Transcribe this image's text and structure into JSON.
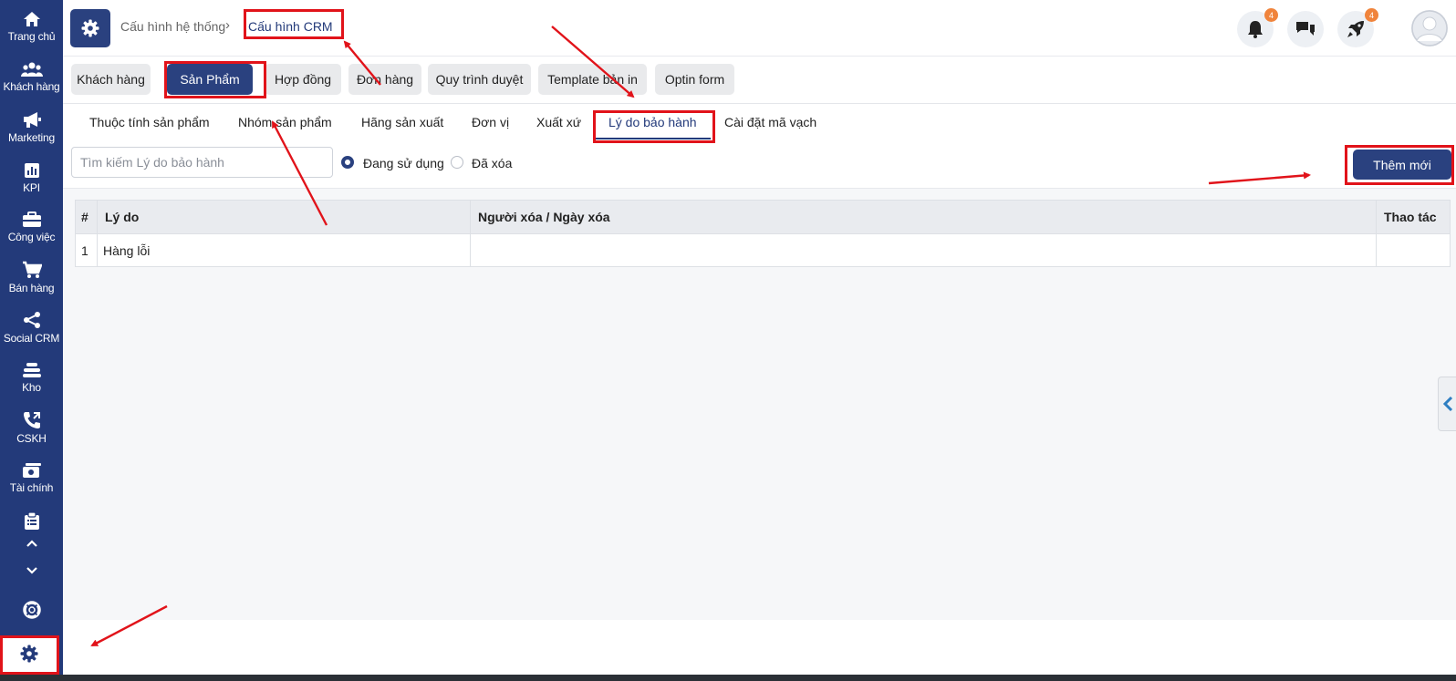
{
  "sidebar": {
    "items": [
      {
        "label": "Trang chủ",
        "icon": "home-icon"
      },
      {
        "label": "Khách hàng",
        "icon": "users-icon"
      },
      {
        "label": "Marketing",
        "icon": "megaphone-icon"
      },
      {
        "label": "KPI",
        "icon": "bar-chart-icon"
      },
      {
        "label": "Công việc",
        "icon": "briefcase-icon"
      },
      {
        "label": "Bán hàng",
        "icon": "cart-icon"
      },
      {
        "label": "Social CRM",
        "icon": "share-icon"
      },
      {
        "label": "Kho",
        "icon": "stack-icon"
      },
      {
        "label": "CSKH",
        "icon": "phone-icon"
      },
      {
        "label": "Tài chính",
        "icon": "money-icon"
      }
    ],
    "extra_icons": [
      "clipboard-icon",
      "chevron-up-icon",
      "chevron-down-icon",
      "lifebuoy-icon",
      "gear-icon"
    ]
  },
  "header": {
    "breadcrumb": {
      "parent": "Cấu hình hệ thống",
      "separator": "›",
      "current": "Cấu hình CRM"
    },
    "notification_count": "4",
    "rocket_count": "4"
  },
  "top_tabs": [
    "Khách hàng",
    "Sản Phẩm",
    "Hợp đồng",
    "Đơn hàng",
    "Quy trình duyệt",
    "Template bản in",
    "Optin form"
  ],
  "top_tab_active": "Sản Phẩm",
  "sub_tabs": [
    "Thuộc tính sản phẩm",
    "Nhóm sản phẩm",
    "Hãng sản xuất",
    "Đơn vị",
    "Xuất xứ",
    "Lý do bảo hành",
    "Cài đặt mã vạch"
  ],
  "sub_tab_active": "Lý do bảo hành",
  "toolbar": {
    "search_placeholder": "Tìm kiếm Lý do bảo hành",
    "radio_active": "Đang sử dụng",
    "radio_deleted": "Đã xóa",
    "add_button": "Thêm mới"
  },
  "table": {
    "columns": [
      "#",
      "Lý do",
      "Người xóa / Ngày xóa",
      "Thao tác"
    ],
    "rows": [
      {
        "index": "1",
        "reason": "Hàng lỗi",
        "deleted_by": "",
        "actions": ""
      }
    ]
  },
  "colors": {
    "primary": "#2a417f",
    "annotation": "#e1131a",
    "badge": "#f0843c"
  }
}
